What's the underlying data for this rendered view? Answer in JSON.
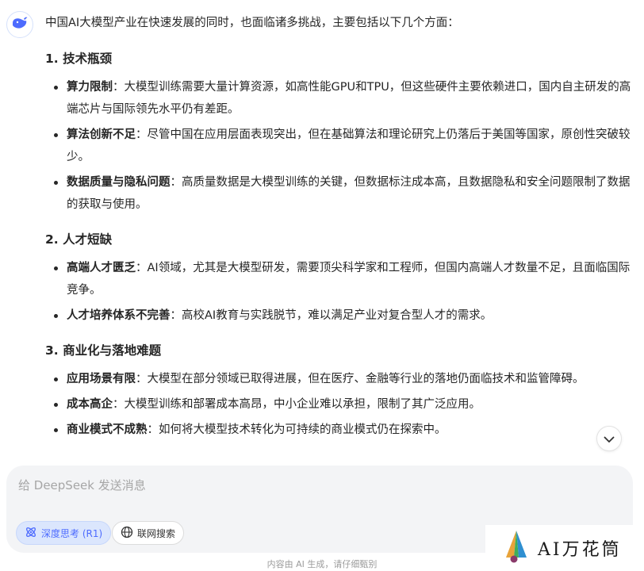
{
  "message": {
    "intro": "中国AI大模型产业在快速发展的同时，也面临诸多挑战，主要包括以下几个方面：",
    "sections": [
      {
        "heading": "1. 技术瓶颈",
        "items": [
          {
            "title": "算力限制",
            "text": "：大模型训练需要大量计算资源，如高性能GPU和TPU，但这些硬件主要依赖进口，国内自主研发的高端芯片与国际领先水平仍有差距。"
          },
          {
            "title": "算法创新不足",
            "text": "：尽管中国在应用层面表现突出，但在基础算法和理论研究上仍落后于美国等国家，原创性突破较少。"
          },
          {
            "title": "数据质量与隐私问题",
            "text": "：高质量数据是大模型训练的关键，但数据标注成本高，且数据隐私和安全问题限制了数据的获取与使用。"
          }
        ]
      },
      {
        "heading": "2. 人才短缺",
        "items": [
          {
            "title": "高端人才匮乏",
            "text": "：AI领域，尤其是大模型研发，需要顶尖科学家和工程师，但国内高端人才数量不足，且面临国际竞争。"
          },
          {
            "title": "人才培养体系不完善",
            "text": "：高校AI教育与实践脱节，难以满足产业对复合型人才的需求。"
          }
        ]
      },
      {
        "heading": "3. 商业化与落地难题",
        "items": [
          {
            "title": "应用场景有限",
            "text": "：大模型在部分领域已取得进展，但在医疗、金融等行业的落地仍面临技术和监管障碍。"
          },
          {
            "title": "成本高企",
            "text": "：大模型训练和部署成本高昂，中小企业难以承担，限制了其广泛应用。"
          },
          {
            "title": "商业模式不成熟",
            "text": "：如何将大模型技术转化为可持续的商业模式仍在探索中。"
          }
        ]
      }
    ]
  },
  "input": {
    "placeholder": "给 DeepSeek 发送消息",
    "deep_think_label": "深度思考 (R1)",
    "web_search_label": "联网搜索"
  },
  "footer_note": "内容由 AI 生成，请仔细甄别",
  "watermark_text": "AI万花筒",
  "icons": {
    "avatar": "deepseek-whale-icon",
    "scroll": "chevron-down-icon",
    "deep_think": "atom-icon",
    "web_search": "globe-icon",
    "watermark": "pen-nib-logo-icon"
  },
  "colors": {
    "accent": "#4d6bfe",
    "text": "#262626",
    "input_bg": "#f3f4f6"
  }
}
